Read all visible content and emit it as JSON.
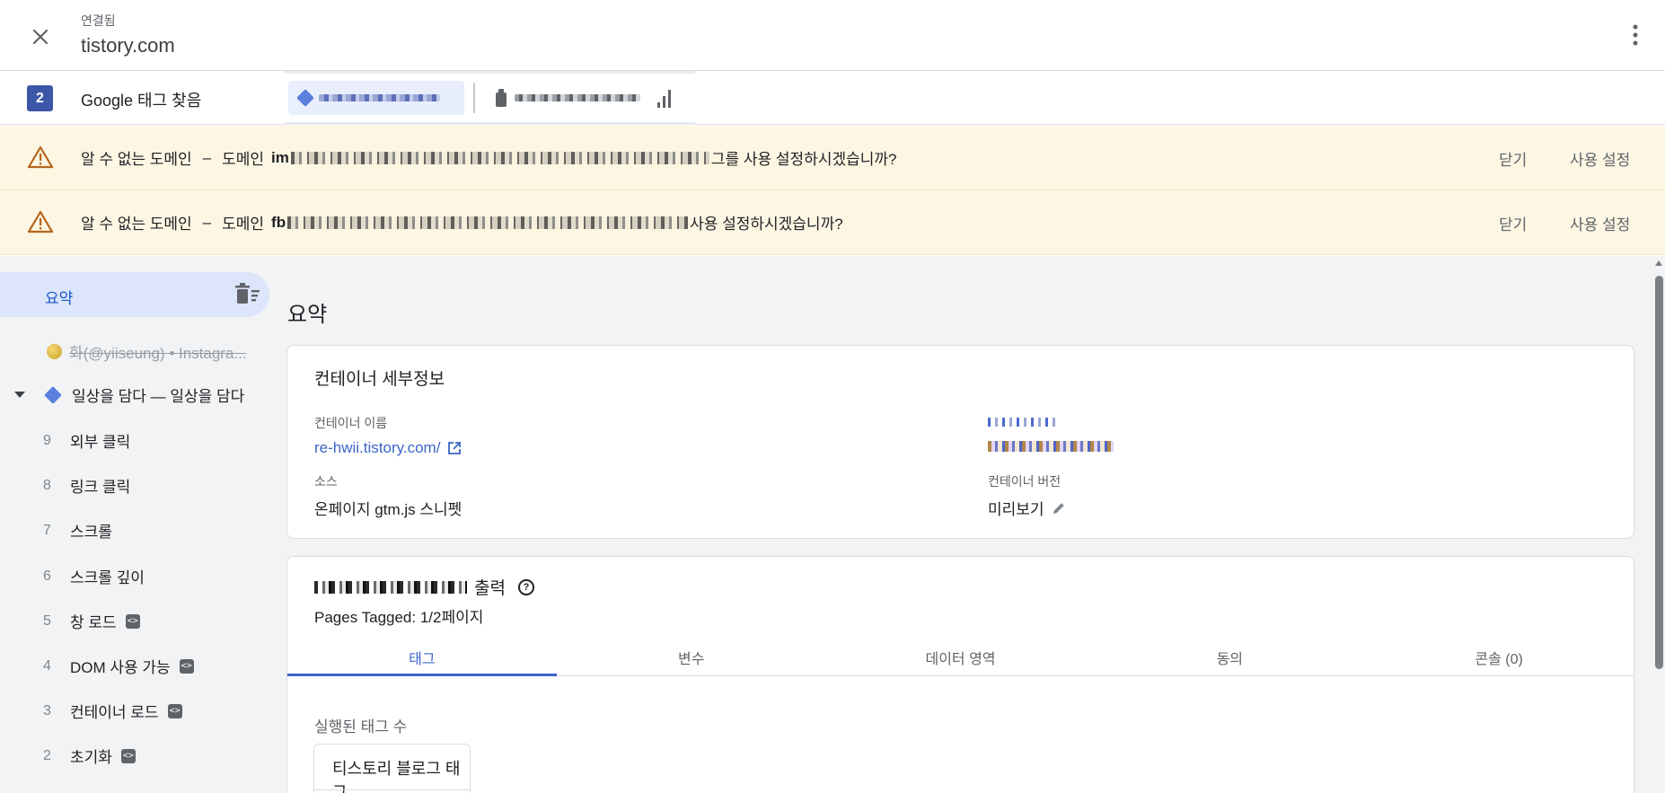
{
  "header": {
    "status": "연결됨",
    "domain": "tistory.com"
  },
  "tag_row": {
    "count": "2",
    "title": "Google 태그 찾음"
  },
  "warnings": [
    {
      "title": "알 수 없는 도메인",
      "dash": "–",
      "prefix": "도메인",
      "domain_start": "im",
      "suffix": "그를 사용 설정하시겠습니까?",
      "close_label": "닫기",
      "enable_label": "사용 설정"
    },
    {
      "title": "알 수 없는 도메인",
      "dash": "–",
      "prefix": "도메인",
      "domain_start": "fb",
      "suffix": "사용 설정하시겠습니까?",
      "close_label": "닫기",
      "enable_label": "사용 설정"
    }
  ],
  "sidebar": {
    "summary_label": "요약",
    "pages": [
      {
        "label": "화(@yiiseung) • Instagra..."
      },
      {
        "label": "일상을 담다 — 일상을 담다"
      }
    ],
    "events": [
      {
        "num": "9",
        "label": "외부 클릭",
        "code": false
      },
      {
        "num": "8",
        "label": "링크 클릭",
        "code": false
      },
      {
        "num": "7",
        "label": "스크롤",
        "code": false
      },
      {
        "num": "6",
        "label": "스크롤 깊이",
        "code": false
      },
      {
        "num": "5",
        "label": "창 로드",
        "code": true
      },
      {
        "num": "4",
        "label": "DOM 사용 가능",
        "code": true
      },
      {
        "num": "3",
        "label": "컨테이너 로드",
        "code": true
      },
      {
        "num": "2",
        "label": "초기화",
        "code": true
      }
    ]
  },
  "main": {
    "title": "요약",
    "container_details": {
      "title": "컨테이너 세부정보",
      "name_label": "컨테이너 이름",
      "name_value": "re-hwii.tistory.com/",
      "source_label": "소스",
      "source_value": "온페이지 gtm.js 스니펫",
      "version_label": "컨테이너 버전",
      "version_value": "미리보기"
    },
    "output": {
      "title_suffix": "출력",
      "pages_tagged": "Pages Tagged: 1/2페이지",
      "tabs": [
        "태그",
        "변수",
        "데이터 영역",
        "동의",
        "콘솔 (0)"
      ],
      "fired_label": "실행된 태그 수",
      "tag_card_label": "티스토리 블로그 태그"
    }
  }
}
